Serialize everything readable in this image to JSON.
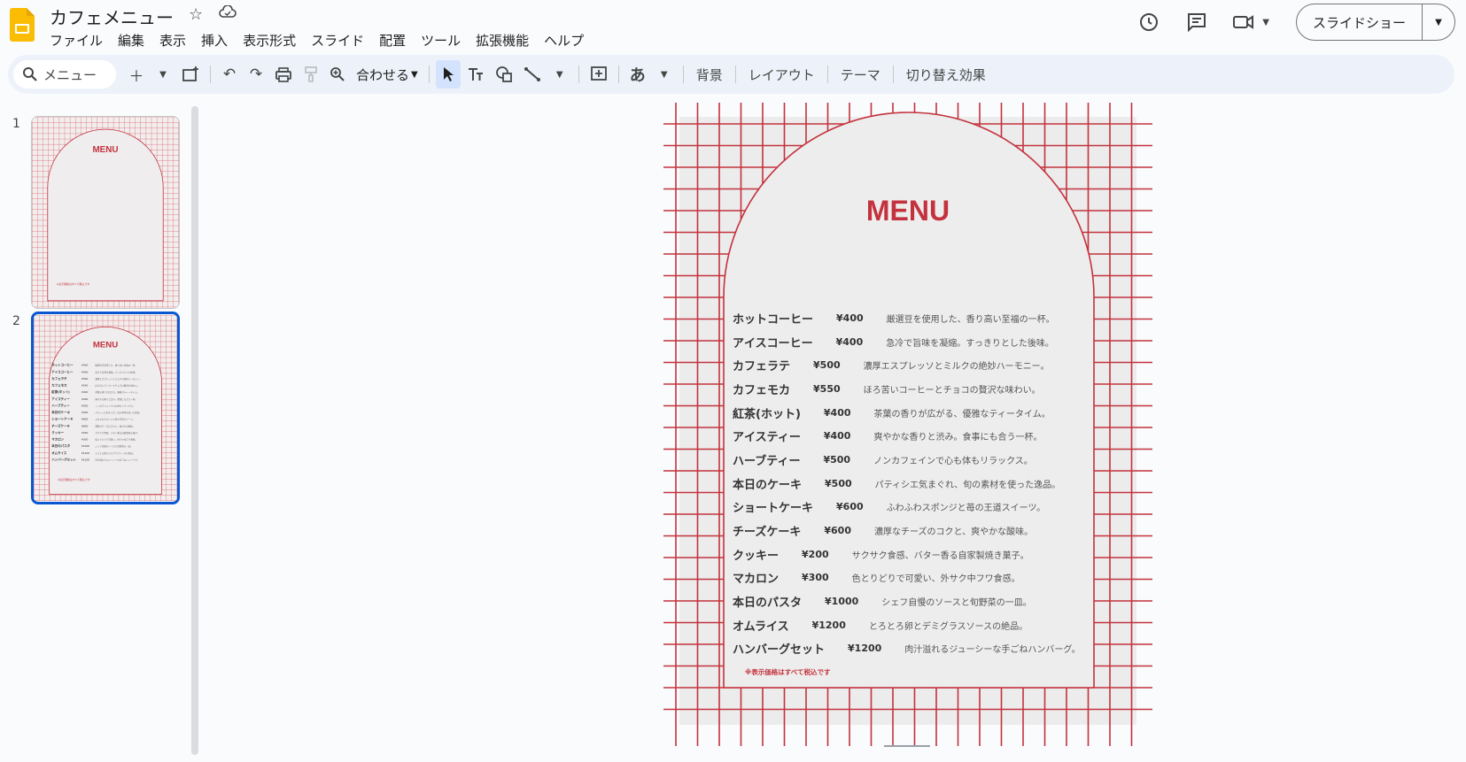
{
  "app": {
    "title": "カフェメニュー",
    "menus": [
      "ファイル",
      "編集",
      "表示",
      "挿入",
      "表示形式",
      "スライド",
      "配置",
      "ツール",
      "拡張機能",
      "ヘルプ"
    ],
    "slideshow_label": "スライドショー"
  },
  "toolbar": {
    "search_value": "メニュー",
    "zoom_label": "合わせる",
    "background_label": "背景",
    "layout_label": "レイアウト",
    "theme_label": "テーマ",
    "transition_label": "切り替え効果",
    "input_tools_label": "あ"
  },
  "filmstrip": {
    "slides": [
      {
        "number": "1",
        "title": "MENU",
        "footer": "※表示価格はすべて税込です"
      },
      {
        "number": "2",
        "title": "MENU",
        "footer": "※表示価格はすべて税込です"
      }
    ]
  },
  "slide": {
    "title": "MENU",
    "footnote": "※表示価格はすべて税込です",
    "accent_color": "#c3323d",
    "items": [
      {
        "name": "ホットコーヒー",
        "price": "¥400",
        "desc": "厳選豆を使用した、香り高い至福の一杯。"
      },
      {
        "name": "アイスコーヒー",
        "price": "¥400",
        "desc": "急冷で旨味を凝縮。すっきりとした後味。"
      },
      {
        "name": "カフェラテ",
        "price": "¥500",
        "desc": "濃厚エスプレッソとミルクの絶妙ハーモニー。"
      },
      {
        "name": "カフェモカ",
        "price": "¥550",
        "desc": "ほろ苦いコーヒーとチョコの贅沢な味わい。"
      },
      {
        "name": "紅茶(ホット)",
        "price": "¥400",
        "desc": "茶葉の香りが広がる、優雅なティータイム。"
      },
      {
        "name": "アイスティー",
        "price": "¥400",
        "desc": "爽やかな香りと渋み。食事にも合う一杯。"
      },
      {
        "name": "ハーブティー",
        "price": "¥500",
        "desc": "ノンカフェインで心も体もリラックス。"
      },
      {
        "name": "本日のケーキ",
        "price": "¥500",
        "desc": "パティシエ気まぐれ、旬の素材を使った逸品。"
      },
      {
        "name": "ショートケーキ",
        "price": "¥600",
        "desc": "ふわふわスポンジと苺の王道スイーツ。"
      },
      {
        "name": "チーズケーキ",
        "price": "¥600",
        "desc": "濃厚なチーズのコクと、爽やかな酸味。"
      },
      {
        "name": "クッキー",
        "price": "¥200",
        "desc": "サクサク食感、バター香る自家製焼き菓子。"
      },
      {
        "name": "マカロン",
        "price": "¥300",
        "desc": "色とりどりで可愛い、外サク中フワ食感。"
      },
      {
        "name": "本日のパスタ",
        "price": "¥1000",
        "desc": "シェフ自慢のソースと旬野菜の一皿。"
      },
      {
        "name": "オムライス",
        "price": "¥1200",
        "desc": "とろとろ卵とデミグラスソースの絶品。"
      },
      {
        "name": "ハンバーグセット",
        "price": "¥1200",
        "desc": "肉汁溢れるジューシーな手ごねハンバーグ。"
      }
    ]
  }
}
